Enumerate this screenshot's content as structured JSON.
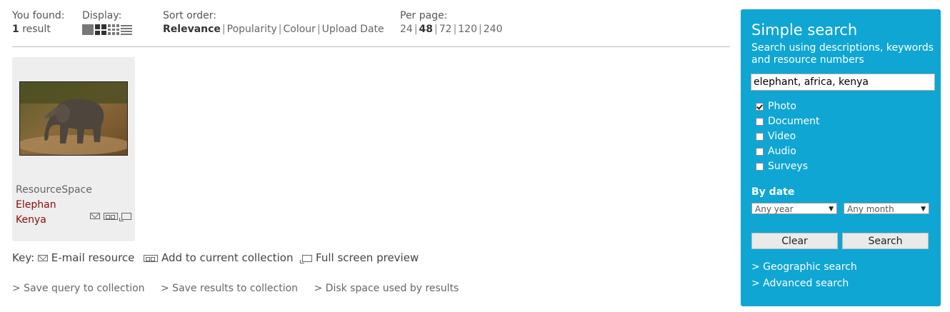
{
  "results": {
    "label": "You found:",
    "count": "1",
    "unit": "result"
  },
  "display": {
    "label": "Display:",
    "modes": [
      "large-thumbs-icon",
      "small-thumbs-icon",
      "xsmall-thumbs-icon",
      "list-icon"
    ]
  },
  "sort": {
    "label": "Sort order:",
    "options": [
      "Relevance",
      "Popularity",
      "Colour",
      "Upload Date"
    ],
    "selected": "Relevance"
  },
  "per_page": {
    "label": "Per page:",
    "options": [
      "24",
      "48",
      "72",
      "120",
      "240"
    ],
    "selected": "48"
  },
  "resource": {
    "prefix": "ResourceSpace",
    "title_part1": "Elephan",
    "title_part2": "Kenya"
  },
  "key": {
    "label": "Key:",
    "email": "E-mail resource",
    "add": "Add to current collection",
    "preview": "Full screen preview"
  },
  "links": {
    "save_query": "> Save query to collection",
    "save_results": "> Save results to collection",
    "disk_space": "> Disk space used by results"
  },
  "panel": {
    "title": "Simple search",
    "description": "Search using descriptions, keywords and resource numbers",
    "query": "elephant, africa, kenya",
    "types": [
      {
        "label": "Photo",
        "checked": true
      },
      {
        "label": "Document",
        "checked": false
      },
      {
        "label": "Video",
        "checked": false
      },
      {
        "label": "Audio",
        "checked": false
      },
      {
        "label": "Surveys",
        "checked": false
      }
    ],
    "by_date": "By date",
    "year": "Any year",
    "month": "Any month",
    "clear": "Clear",
    "search": "Search",
    "geo_link": "> Geographic search",
    "adv_link": "> Advanced search",
    "accent_color": "#0fa6d3"
  }
}
